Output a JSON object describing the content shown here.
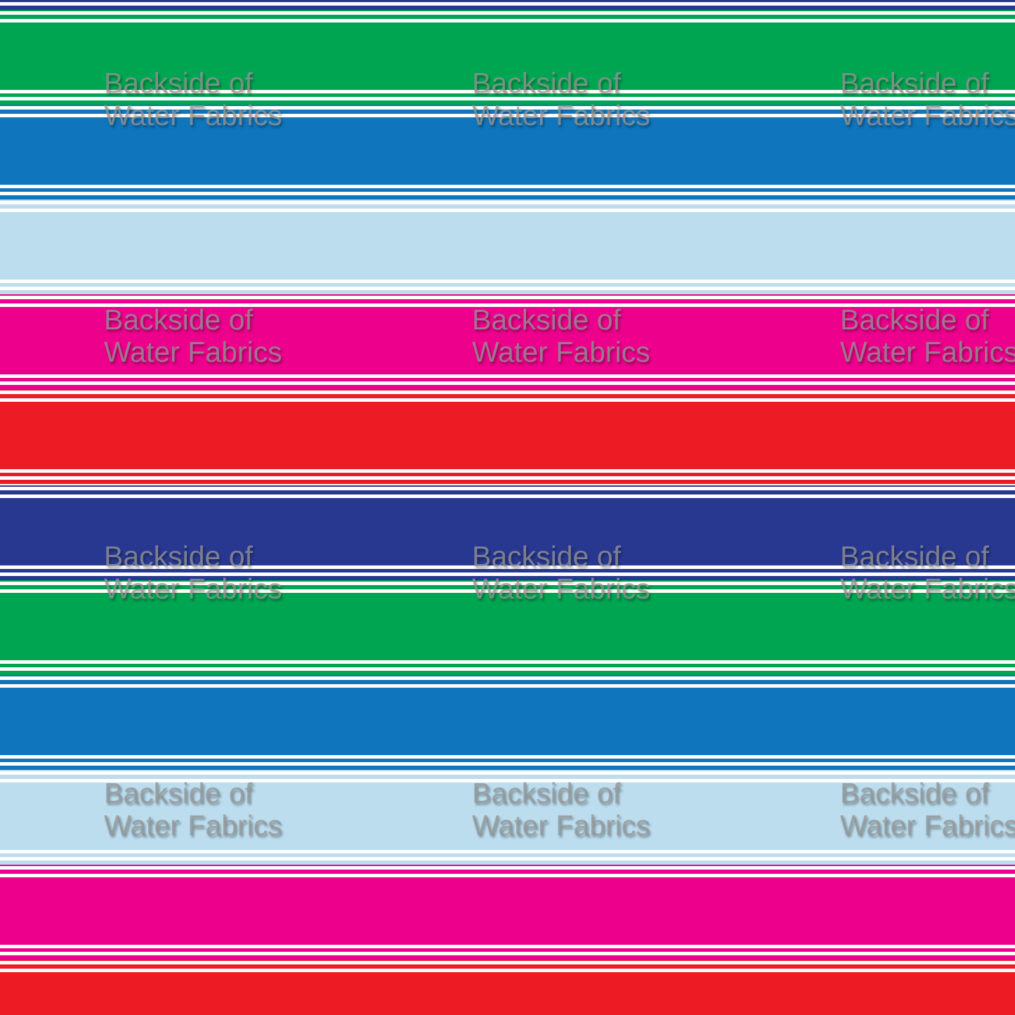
{
  "colors": {
    "navy": "#283891",
    "green": "#00a551",
    "blue": "#0f75bc",
    "light_blue": "#bbddee",
    "pink": "#ec008c",
    "red": "#ed1c24",
    "white": "#ffffff"
  },
  "watermark": {
    "line1": "Backside of",
    "line2": "Water Fabrics"
  }
}
